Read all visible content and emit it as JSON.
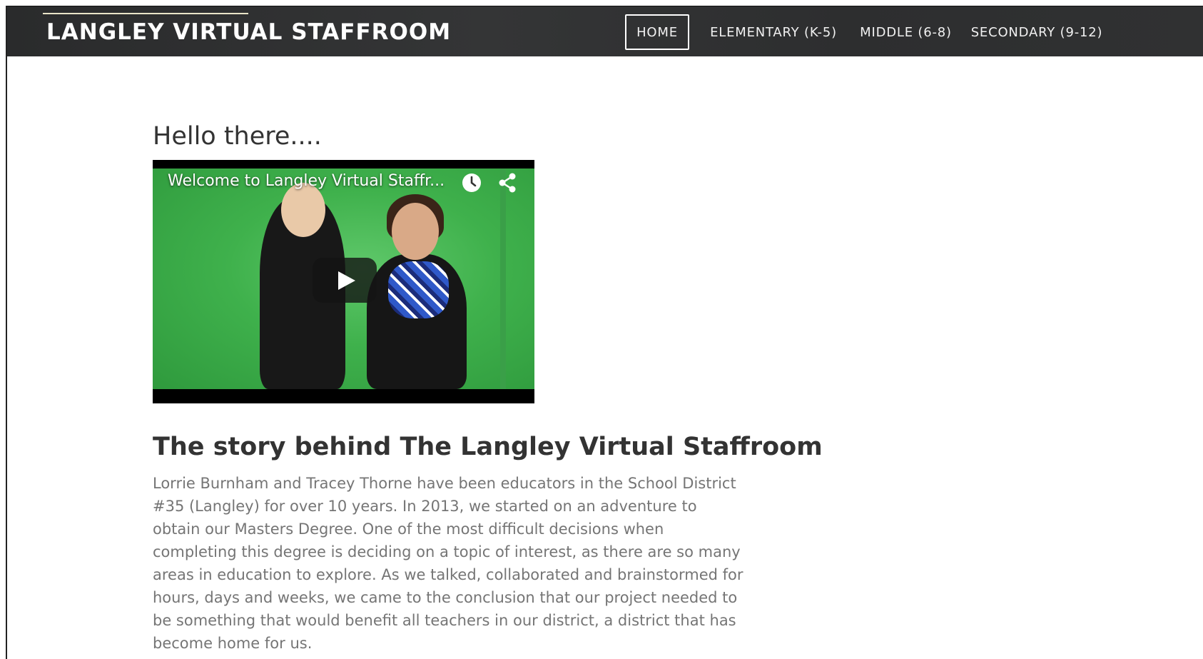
{
  "header": {
    "site_title": "LANGLEY VIRTUAL STAFFROOM",
    "nav": [
      {
        "label": "HOME",
        "active": true
      },
      {
        "label": "ELEMENTARY (K-5)",
        "active": false
      },
      {
        "label": "MIDDLE (6-8)",
        "active": false
      },
      {
        "label": "SECONDARY (9-12)",
        "active": false
      }
    ]
  },
  "main": {
    "greeting": "Hello there....",
    "video": {
      "title": "Welcome to Langley Virtual Staffr...",
      "icons": [
        "clock-icon",
        "share-icon",
        "play-icon"
      ]
    },
    "story": {
      "heading": "The story behind The Langley Virtual Staffroom",
      "body": "Lorrie Burnham and Tracey Thorne have been educators in the School District #35 (Langley) for over 10 years. In 2013, we started on an adventure to obtain our Masters Degree. One of the most difficult decisions when completing this degree is deciding on a topic of interest, as there are so many areas in education to explore. As we talked, collaborated and brainstormed for hours, days and weeks, we came to the conclusion that our project needed to be something that would benefit all teachers in our district, a district that has become home for us."
    }
  },
  "colors": {
    "header_bg": "#2f3031",
    "text_dark": "#333333",
    "text_body": "#757575",
    "video_green": "#3fb14c"
  }
}
